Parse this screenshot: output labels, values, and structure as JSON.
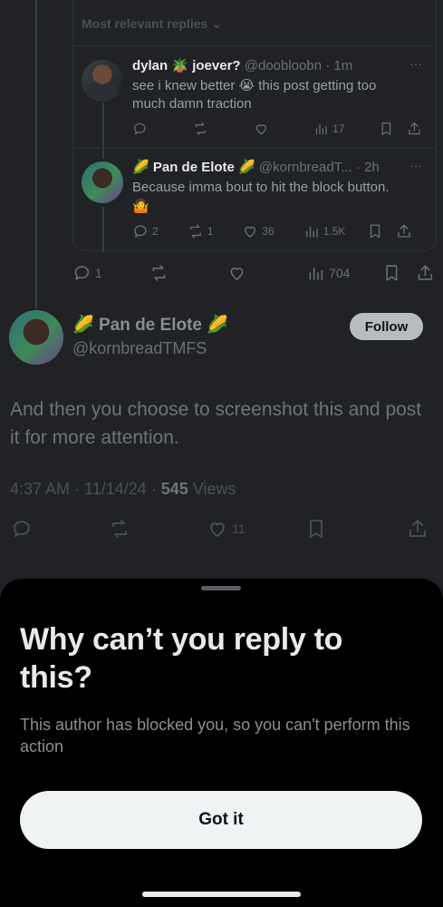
{
  "replies_header": {
    "label": "Most relevant replies"
  },
  "reply1": {
    "name": "dylan",
    "name_suffix": "joever?",
    "handle_time": "@doobloobn · 1m",
    "text": "see i knew better 😭 this post getting too much damn traction",
    "views": "17"
  },
  "reply2": {
    "name": "Pan de Elote",
    "handle_time": "@kornbreadT... · 2h",
    "text": "Because imma bout to hit the block button.",
    "emoji": "🤷",
    "replies": "2",
    "reposts": "1",
    "likes": "36",
    "views": "1.5K"
  },
  "quote_actions": {
    "replies": "1",
    "views": "704"
  },
  "main_post": {
    "name": "Pan de Elote",
    "handle": "@kornbreadTMFS",
    "follow_label": "Follow",
    "text": "And then you choose to screenshot this and post it for more attention.",
    "timestamp": "4:37 AM · 11/14/24 · ",
    "views_count": "545",
    "views_label": " Views",
    "likes": "11"
  },
  "sheet": {
    "title": "Why can’t you reply to this?",
    "message": "This author has blocked you, so you can't perform this action",
    "button_label": "Got it"
  },
  "colors": {
    "background": "#202225",
    "sheet": "#000000",
    "button": "#eff3f4",
    "accent_emoji": "#e8b828"
  }
}
